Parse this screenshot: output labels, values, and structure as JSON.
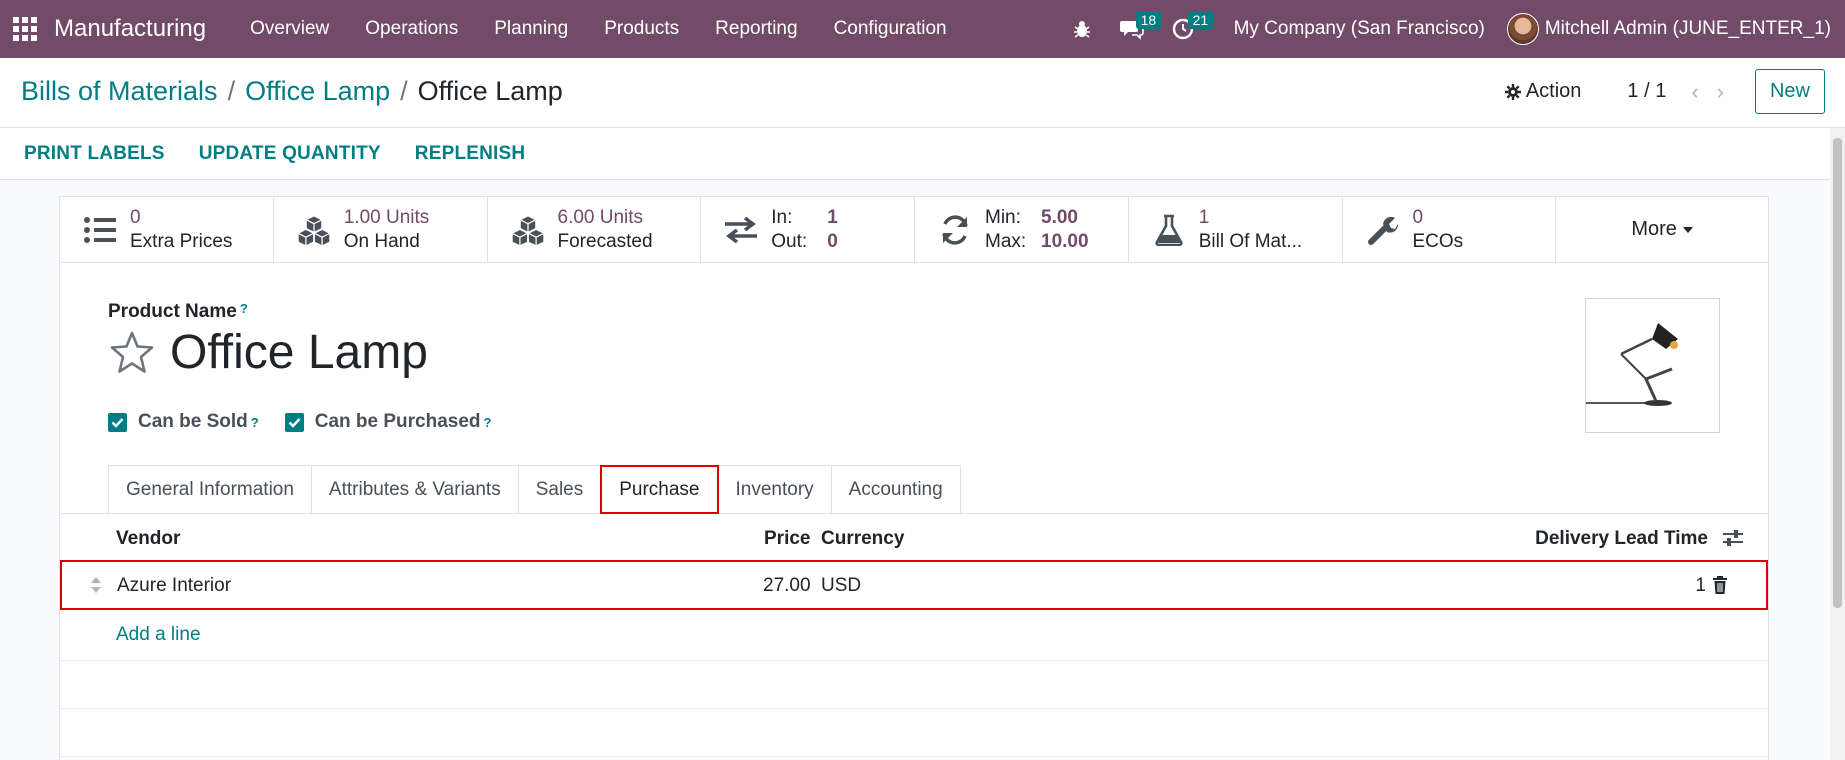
{
  "navbar": {
    "app_name": "Manufacturing",
    "menu": [
      "Overview",
      "Operations",
      "Planning",
      "Products",
      "Reporting",
      "Configuration"
    ],
    "messages_count": "18",
    "activities_count": "21",
    "company": "My Company (San Francisco)",
    "user": "Mitchell Admin (JUNE_ENTER_1)"
  },
  "breadcrumb": {
    "root": "Bills of Materials",
    "middle": "Office Lamp",
    "current": "Office Lamp"
  },
  "control": {
    "action_label": "Action",
    "pager": "1 / 1",
    "new_label": "New"
  },
  "statusbar": {
    "buttons": [
      "PRINT LABELS",
      "UPDATE QUANTITY",
      "REPLENISH"
    ]
  },
  "smart_buttons": {
    "extra_prices_value": "0",
    "extra_prices_label": "Extra Prices",
    "on_hand_value": "1.00 Units",
    "on_hand_label": "On Hand",
    "forecasted_value": "6.00 Units",
    "forecasted_label": "Forecasted",
    "in_label": "In:",
    "in_value": "1",
    "out_label": "Out:",
    "out_value": "0",
    "min_label": "Min:",
    "min_value": "5.00",
    "max_label": "Max:",
    "max_value": "10.00",
    "bom_value": "1",
    "bom_label": "Bill Of Mat...",
    "ecos_value": "0",
    "ecos_label": "ECOs",
    "more_label": "More"
  },
  "form": {
    "product_name_label": "Product Name",
    "help_mark": "?",
    "product_name": "Office Lamp",
    "can_be_sold": "Can be Sold",
    "can_be_purchased": "Can be Purchased"
  },
  "tabs": [
    "General Information",
    "Attributes & Variants",
    "Sales",
    "Purchase",
    "Inventory",
    "Accounting"
  ],
  "active_tab": "Purchase",
  "vendor_table": {
    "columns": {
      "vendor": "Vendor",
      "price": "Price",
      "currency": "Currency",
      "lead_time": "Delivery Lead Time"
    },
    "rows": [
      {
        "vendor": "Azure Interior",
        "price": "27.00",
        "currency": "USD",
        "lead_time": "1"
      }
    ],
    "add_line": "Add a line"
  },
  "colors": {
    "navbar": "#714b67",
    "accent": "#017e84",
    "highlight": "#dd0000"
  }
}
